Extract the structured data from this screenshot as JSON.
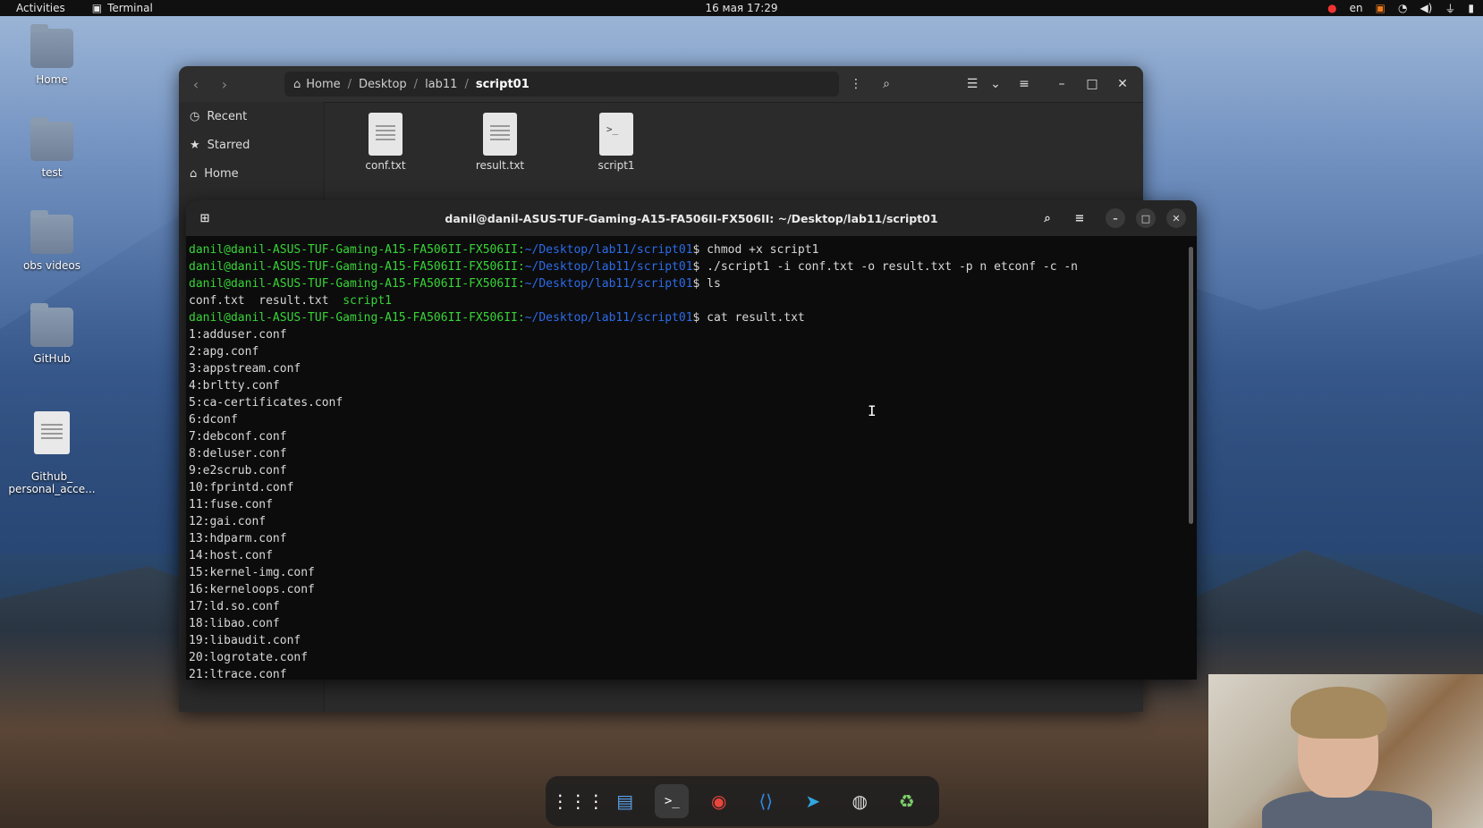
{
  "topbar": {
    "activities": "Activities",
    "app_name": "Terminal",
    "clock": "16 мая  17:29",
    "language": "en"
  },
  "desktop": {
    "icons": [
      {
        "label": "Home",
        "icon": "home-folder-icon"
      },
      {
        "label": "test",
        "icon": "folder-icon"
      },
      {
        "label": "obs videos",
        "icon": "folder-icon"
      },
      {
        "label": "GitHub",
        "icon": "folder-icon"
      },
      {
        "label": "Github_\npersonal_acce...",
        "icon": "text-file-icon"
      }
    ]
  },
  "files": {
    "path": [
      "Home",
      "Desktop",
      "lab11",
      "script01"
    ],
    "sidebar": [
      "Recent",
      "Starred",
      "Home"
    ],
    "items": [
      {
        "label": "conf.txt",
        "icon": "text-file-icon"
      },
      {
        "label": "result.txt",
        "icon": "text-file-icon"
      },
      {
        "label": "script1",
        "icon": "script-file-icon"
      }
    ]
  },
  "terminal": {
    "title": "danil@danil-ASUS-TUF-Gaming-A15-FA506II-FX506II: ~/Desktop/lab11/script01",
    "prompt_user": "danil@danil-ASUS-TUF-Gaming-A15-FA506II-FX506II",
    "prompt_path": "~/Desktop/lab11/script01",
    "commands": [
      "chmod +x script1",
      "./script1 -i conf.txt -o result.txt -p n etconf -c -n",
      "ls"
    ],
    "ls_output": [
      "conf.txt",
      "result.txt",
      "script1"
    ],
    "last_command": "cat result.txt",
    "output_lines": [
      "1:adduser.conf",
      "2:apg.conf",
      "3:appstream.conf",
      "4:brltty.conf",
      "5:ca-certificates.conf",
      "6:dconf",
      "7:debconf.conf",
      "8:deluser.conf",
      "9:e2scrub.conf",
      "10:fprintd.conf",
      "11:fuse.conf",
      "12:gai.conf",
      "13:hdparm.conf",
      "14:host.conf",
      "15:kernel-img.conf",
      "16:kerneloops.conf",
      "17:ld.so.conf",
      "18:libao.conf",
      "19:libaudit.conf",
      "20:logrotate.conf",
      "21:ltrace.conf"
    ]
  },
  "dock": [
    {
      "name": "app-grid-icon",
      "glyph": "⋮⋮⋮"
    },
    {
      "name": "files-icon",
      "glyph": "▤"
    },
    {
      "name": "terminal-icon",
      "glyph": ">_"
    },
    {
      "name": "chrome-icon",
      "glyph": "◉"
    },
    {
      "name": "vscode-icon",
      "glyph": "⟨⟩"
    },
    {
      "name": "telegram-icon",
      "glyph": "➤"
    },
    {
      "name": "obs-icon",
      "glyph": "◍"
    },
    {
      "name": "trash-icon",
      "glyph": "♻"
    }
  ]
}
